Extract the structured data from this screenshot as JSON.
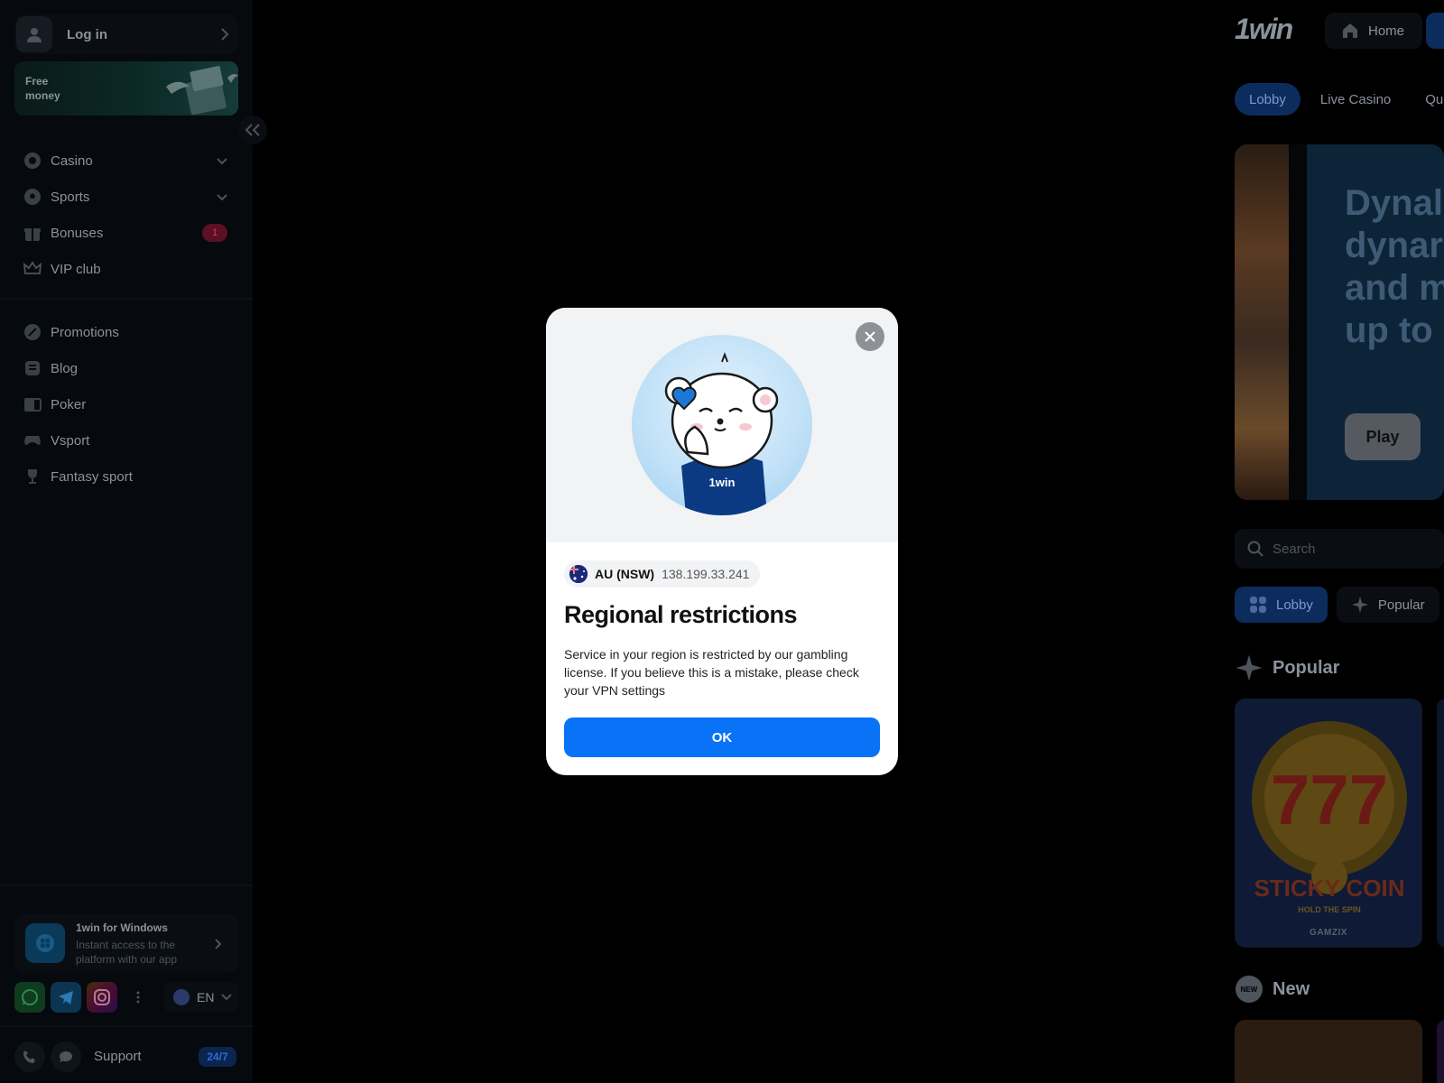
{
  "sidebar": {
    "login_label": "Log in",
    "promo_label": "Free money",
    "nav_primary": [
      {
        "label": "Casino",
        "icon": "casino-chip-icon",
        "expand": true
      },
      {
        "label": "Sports",
        "icon": "soccer-ball-icon",
        "expand": true
      },
      {
        "label": "Bonuses",
        "icon": "gift-icon",
        "badge": "1"
      },
      {
        "label": "VIP club",
        "icon": "crown-icon"
      }
    ],
    "nav_secondary": [
      {
        "label": "Promotions",
        "icon": "percent-badge-icon"
      },
      {
        "label": "Blog",
        "icon": "document-icon"
      },
      {
        "label": "Poker",
        "icon": "poker-cards-icon"
      },
      {
        "label": "Vsport",
        "icon": "gamepad-icon"
      },
      {
        "label": "Fantasy sport",
        "icon": "trophy-icon"
      }
    ],
    "windows_app": {
      "title": "1win for Windows",
      "subtitle": "Instant access to the platform with our app"
    },
    "language": "EN",
    "support": {
      "label": "Support",
      "hours": "24/7"
    }
  },
  "main": {
    "brand": "1win",
    "home_label": "Home",
    "tabs": [
      "Lobby",
      "Live Casino",
      "Quic"
    ],
    "banner": {
      "headline": "Dynal\ndynar\nand m\nup to",
      "play_label": "Play"
    },
    "search_placeholder": "Search",
    "chips": [
      "Lobby",
      "Popular"
    ],
    "sections": {
      "popular": "Popular",
      "new": "New",
      "new_badge": "NEW"
    },
    "games": [
      {
        "title_line1": "777",
        "title_line2": "STICKY COIN",
        "tagline": "HOLD THE SPIN",
        "provider": "GAMZIX"
      }
    ]
  },
  "modal": {
    "region": "AU (NSW)",
    "ip": "138.199.33.241",
    "title": "Regional restrictions",
    "description": "Service in your region is restricted by our gambling license. If you believe this is a mistake, please check your VPN settings",
    "ok_label": "OK",
    "mascot_shirt": "1win"
  },
  "colors": {
    "accent": "#0873f6",
    "overlay": "#000000",
    "modal_bg": "#ffffff",
    "badge": "#5d0f24"
  }
}
